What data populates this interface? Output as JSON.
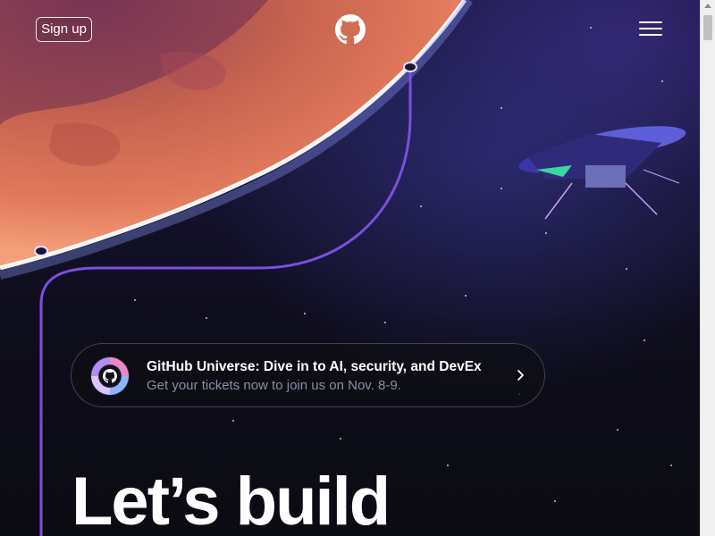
{
  "header": {
    "signup_label": "Sign up",
    "logo_icon": "github-mark-icon",
    "menu_icon": "hamburger-menu-icon"
  },
  "banner": {
    "icon": "universe-github-icon",
    "title": "GitHub Universe: Dive in to AI, security, and DevEx",
    "subtitle": "Get your tickets now to join us on Nov. 8-9.",
    "chevron_icon": "chevron-right-icon"
  },
  "hero": {
    "headline": "Let’s build"
  },
  "colors": {
    "background": "#0d1117",
    "accent_line": "#7b4fe0",
    "planet": "#d66a55"
  }
}
